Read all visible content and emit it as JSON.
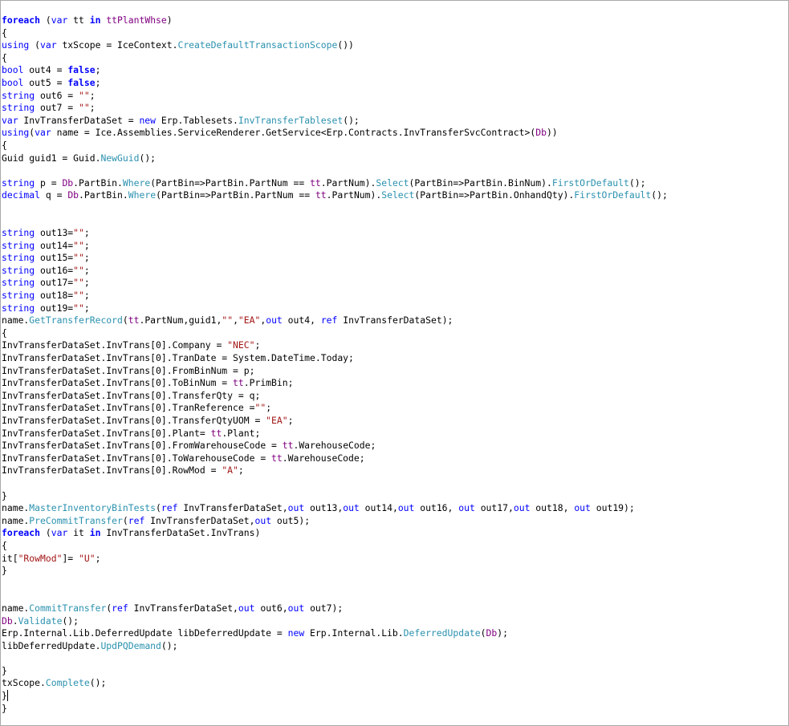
{
  "lines": [
    [
      [
        "foreach",
        "kwb"
      ],
      [
        " (",
        ""
      ],
      [
        "var",
        "kw"
      ],
      [
        " tt ",
        ""
      ],
      [
        "in",
        "kwb"
      ],
      [
        " ",
        ""
      ],
      [
        "ttPlantWhse",
        "pu"
      ],
      [
        ")",
        ""
      ]
    ],
    [
      [
        "{",
        ""
      ]
    ],
    [
      [
        "using",
        "kw"
      ],
      [
        " (",
        ""
      ],
      [
        "var",
        "kw"
      ],
      [
        " txScope = IceContext.",
        ""
      ],
      [
        "CreateDefaultTransactionScope",
        "ty"
      ],
      [
        "())",
        ""
      ]
    ],
    [
      [
        "{",
        ""
      ]
    ],
    [
      [
        "bool",
        "kw"
      ],
      [
        " out4 = ",
        ""
      ],
      [
        "false",
        "kwb"
      ],
      [
        ";",
        ""
      ]
    ],
    [
      [
        "bool",
        "kw"
      ],
      [
        " out5 = ",
        ""
      ],
      [
        "false",
        "kwb"
      ],
      [
        ";",
        ""
      ]
    ],
    [
      [
        "string",
        "kw"
      ],
      [
        " out6 = ",
        ""
      ],
      [
        "\"\"",
        "str"
      ],
      [
        ";",
        ""
      ]
    ],
    [
      [
        "string",
        "kw"
      ],
      [
        " out7 = ",
        ""
      ],
      [
        "\"\"",
        "str"
      ],
      [
        ";",
        ""
      ]
    ],
    [
      [
        "var",
        "kw"
      ],
      [
        " InvTransferDataSet = ",
        ""
      ],
      [
        "new",
        "kw"
      ],
      [
        " Erp.Tablesets.",
        ""
      ],
      [
        "InvTransferTableset",
        "ty"
      ],
      [
        "();",
        ""
      ]
    ],
    [
      [
        "using",
        "kw"
      ],
      [
        "(",
        ""
      ],
      [
        "var",
        "kw"
      ],
      [
        " name = Ice.Assemblies.ServiceRenderer.GetService<Erp.Contracts.InvTransferSvcContract>(",
        ""
      ],
      [
        "Db",
        "pu"
      ],
      [
        "))",
        ""
      ]
    ],
    [
      [
        "{",
        ""
      ]
    ],
    [
      [
        "Guid guid1 = Guid.",
        ""
      ],
      [
        "NewGuid",
        "ty"
      ],
      [
        "();",
        ""
      ]
    ],
    [],
    [
      [
        "string",
        "kw"
      ],
      [
        " p = ",
        ""
      ],
      [
        "Db",
        "pu"
      ],
      [
        ".PartBin.",
        ""
      ],
      [
        "Where",
        "ty"
      ],
      [
        "(PartBin=>PartBin.PartNum == ",
        ""
      ],
      [
        "tt",
        "pu"
      ],
      [
        ".PartNum).",
        ""
      ],
      [
        "Select",
        "ty"
      ],
      [
        "(PartBin=>PartBin.BinNum).",
        ""
      ],
      [
        "FirstOrDefault",
        "ty"
      ],
      [
        "();",
        ""
      ]
    ],
    [
      [
        "decimal",
        "kw"
      ],
      [
        " q = ",
        ""
      ],
      [
        "Db",
        "pu"
      ],
      [
        ".PartBin.",
        ""
      ],
      [
        "Where",
        "ty"
      ],
      [
        "(PartBin=>PartBin.PartNum == ",
        ""
      ],
      [
        "tt",
        "pu"
      ],
      [
        ".PartNum).",
        ""
      ],
      [
        "Select",
        "ty"
      ],
      [
        "(PartBin=>PartBin.OnhandQty).",
        ""
      ],
      [
        "FirstOrDefault",
        "ty"
      ],
      [
        "();",
        ""
      ]
    ],
    [],
    [],
    [
      [
        "string",
        "kw"
      ],
      [
        " out13=",
        ""
      ],
      [
        "\"\"",
        "str"
      ],
      [
        ";",
        ""
      ]
    ],
    [
      [
        "string",
        "kw"
      ],
      [
        " out14=",
        ""
      ],
      [
        "\"\"",
        "str"
      ],
      [
        ";",
        ""
      ]
    ],
    [
      [
        "string",
        "kw"
      ],
      [
        " out15=",
        ""
      ],
      [
        "\"\"",
        "str"
      ],
      [
        ";",
        ""
      ]
    ],
    [
      [
        "string",
        "kw"
      ],
      [
        " out16=",
        ""
      ],
      [
        "\"\"",
        "str"
      ],
      [
        ";",
        ""
      ]
    ],
    [
      [
        "string",
        "kw"
      ],
      [
        " out17=",
        ""
      ],
      [
        "\"\"",
        "str"
      ],
      [
        ";",
        ""
      ]
    ],
    [
      [
        "string",
        "kw"
      ],
      [
        " out18=",
        ""
      ],
      [
        "\"\"",
        "str"
      ],
      [
        ";",
        ""
      ]
    ],
    [
      [
        "string",
        "kw"
      ],
      [
        " out19=",
        ""
      ],
      [
        "\"\"",
        "str"
      ],
      [
        ";",
        ""
      ]
    ],
    [
      [
        "name.",
        ""
      ],
      [
        "GetTransferRecord",
        "ty"
      ],
      [
        "(",
        ""
      ],
      [
        "tt",
        "pu"
      ],
      [
        ".PartNum,guid1,",
        ""
      ],
      [
        "\"\"",
        "str"
      ],
      [
        ",",
        ""
      ],
      [
        "\"EA\"",
        "str"
      ],
      [
        ",",
        ""
      ],
      [
        "out",
        "kw"
      ],
      [
        " out4, ",
        ""
      ],
      [
        "ref",
        "kw"
      ],
      [
        " InvTransferDataSet);",
        ""
      ]
    ],
    [
      [
        "{",
        ""
      ]
    ],
    [
      [
        "InvTransferDataSet.InvTrans[0].Company = ",
        ""
      ],
      [
        "\"NEC\"",
        "str"
      ],
      [
        ";",
        ""
      ]
    ],
    [
      [
        "InvTransferDataSet.InvTrans[0].TranDate = System.DateTime.Today;",
        ""
      ]
    ],
    [
      [
        "InvTransferDataSet.InvTrans[0].FromBinNum = p;",
        ""
      ]
    ],
    [
      [
        "InvTransferDataSet.InvTrans[0].ToBinNum = ",
        ""
      ],
      [
        "tt",
        "pu"
      ],
      [
        ".PrimBin;",
        ""
      ]
    ],
    [
      [
        "InvTransferDataSet.InvTrans[0].TransferQty = q;",
        ""
      ]
    ],
    [
      [
        "InvTransferDataSet.InvTrans[0].TranReference =",
        ""
      ],
      [
        "\"\"",
        "str"
      ],
      [
        ";",
        ""
      ]
    ],
    [
      [
        "InvTransferDataSet.InvTrans[0].TransferQtyUOM = ",
        ""
      ],
      [
        "\"EA\"",
        "str"
      ],
      [
        ";",
        ""
      ]
    ],
    [
      [
        "InvTransferDataSet.InvTrans[0].Plant= ",
        ""
      ],
      [
        "tt",
        "pu"
      ],
      [
        ".Plant;",
        ""
      ]
    ],
    [
      [
        "InvTransferDataSet.InvTrans[0].FromWarehouseCode = ",
        ""
      ],
      [
        "tt",
        "pu"
      ],
      [
        ".WarehouseCode;",
        ""
      ]
    ],
    [
      [
        "InvTransferDataSet.InvTrans[0].ToWarehouseCode = ",
        ""
      ],
      [
        "tt",
        "pu"
      ],
      [
        ".WarehouseCode;",
        ""
      ]
    ],
    [
      [
        "InvTransferDataSet.InvTrans[0].RowMod = ",
        ""
      ],
      [
        "\"A\"",
        "str"
      ],
      [
        ";",
        ""
      ]
    ],
    [],
    [
      [
        "}",
        ""
      ]
    ],
    [
      [
        "name.",
        ""
      ],
      [
        "MasterInventoryBinTests",
        "ty"
      ],
      [
        "(",
        ""
      ],
      [
        "ref",
        "kw"
      ],
      [
        " InvTransferDataSet,",
        ""
      ],
      [
        "out",
        "kw"
      ],
      [
        " out13,",
        ""
      ],
      [
        "out",
        "kw"
      ],
      [
        " out14,",
        ""
      ],
      [
        "out",
        "kw"
      ],
      [
        " out16, ",
        ""
      ],
      [
        "out",
        "kw"
      ],
      [
        " out17,",
        ""
      ],
      [
        "out",
        "kw"
      ],
      [
        " out18, ",
        ""
      ],
      [
        "out",
        "kw"
      ],
      [
        " out19);",
        ""
      ]
    ],
    [
      [
        "name.",
        ""
      ],
      [
        "PreCommitTransfer",
        "ty"
      ],
      [
        "(",
        ""
      ],
      [
        "ref",
        "kw"
      ],
      [
        " InvTransferDataSet,",
        ""
      ],
      [
        "out",
        "kw"
      ],
      [
        " out5);",
        ""
      ]
    ],
    [
      [
        "foreach",
        "kwb"
      ],
      [
        " (",
        ""
      ],
      [
        "var",
        "kw"
      ],
      [
        " it ",
        ""
      ],
      [
        "in",
        "kwb"
      ],
      [
        " InvTransferDataSet.InvTrans)",
        ""
      ]
    ],
    [
      [
        "{",
        ""
      ]
    ],
    [
      [
        "it[",
        ""
      ],
      [
        "\"RowMod\"",
        "str"
      ],
      [
        "]= ",
        ""
      ],
      [
        "\"U\"",
        "str"
      ],
      [
        ";",
        ""
      ]
    ],
    [
      [
        "}",
        ""
      ]
    ],
    [],
    [],
    [
      [
        "name.",
        ""
      ],
      [
        "CommitTransfer",
        "ty"
      ],
      [
        "(",
        ""
      ],
      [
        "ref",
        "kw"
      ],
      [
        " InvTransferDataSet,",
        ""
      ],
      [
        "out",
        "kw"
      ],
      [
        " out6,",
        ""
      ],
      [
        "out",
        "kw"
      ],
      [
        " out7);",
        ""
      ]
    ],
    [
      [
        "Db",
        "pu"
      ],
      [
        ".",
        ""
      ],
      [
        "Validate",
        "ty"
      ],
      [
        "();",
        ""
      ]
    ],
    [
      [
        "Erp.Internal.Lib.DeferredUpdate libDeferredUpdate = ",
        ""
      ],
      [
        "new",
        "kw"
      ],
      [
        " Erp.Internal.Lib.",
        ""
      ],
      [
        "DeferredUpdate",
        "ty"
      ],
      [
        "(",
        ""
      ],
      [
        "Db",
        "pu"
      ],
      [
        ");",
        ""
      ]
    ],
    [
      [
        "libDeferredUpdate.",
        ""
      ],
      [
        "UpdPQDemand",
        "ty"
      ],
      [
        "();",
        ""
      ]
    ],
    [],
    [
      [
        "}",
        ""
      ]
    ],
    [
      [
        "txScope.",
        ""
      ],
      [
        "Complete",
        "ty"
      ],
      [
        "();",
        ""
      ]
    ],
    [
      [
        "}",
        ""
      ]
    ],
    [
      [
        "}",
        ""
      ]
    ]
  ],
  "caret_line": 54,
  "colors": {
    "keyword": "#0000ff",
    "type_member": "#2b91af",
    "string": "#a31515",
    "parameter": "#800080",
    "text": "#000000",
    "background": "#ffffff",
    "border": "#a9a9a9"
  }
}
